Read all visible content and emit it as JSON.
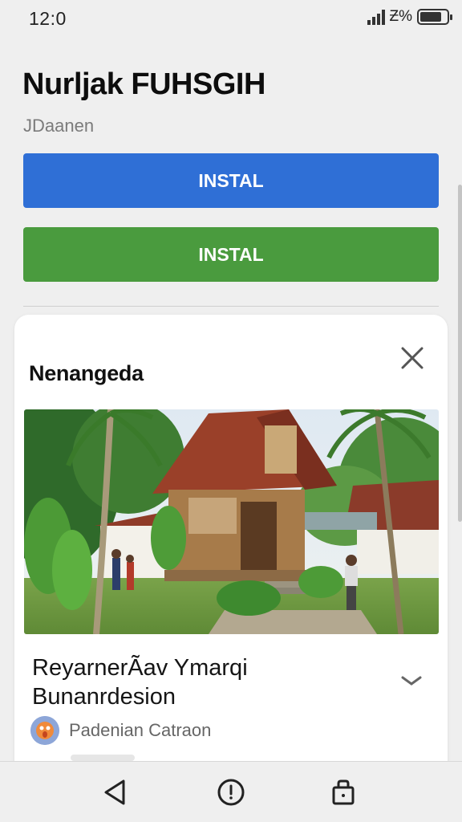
{
  "status_bar": {
    "time": "12:0",
    "network": "Ƶ%",
    "battery_level": 0.8
  },
  "header": {
    "title": "Nurljak FUHSGIH",
    "subtitle": "JDaanen"
  },
  "buttons": {
    "primary_label": "INSTAL",
    "secondary_label": "INSTAL",
    "primary_color": "#2f6fd6",
    "secondary_color": "#4a9b3e"
  },
  "card": {
    "title": "Nenangeda",
    "image_icon": "photo-image",
    "place_title_line1": "ReyarnerÃav Ymarqi",
    "place_title_line2": "Bunanrdesion",
    "author": "Padenian Catraon"
  },
  "icons": {
    "close": "close-icon",
    "expand": "chevron-down-icon",
    "back": "back-icon",
    "home": "home-icon",
    "recent": "lock-icon"
  }
}
